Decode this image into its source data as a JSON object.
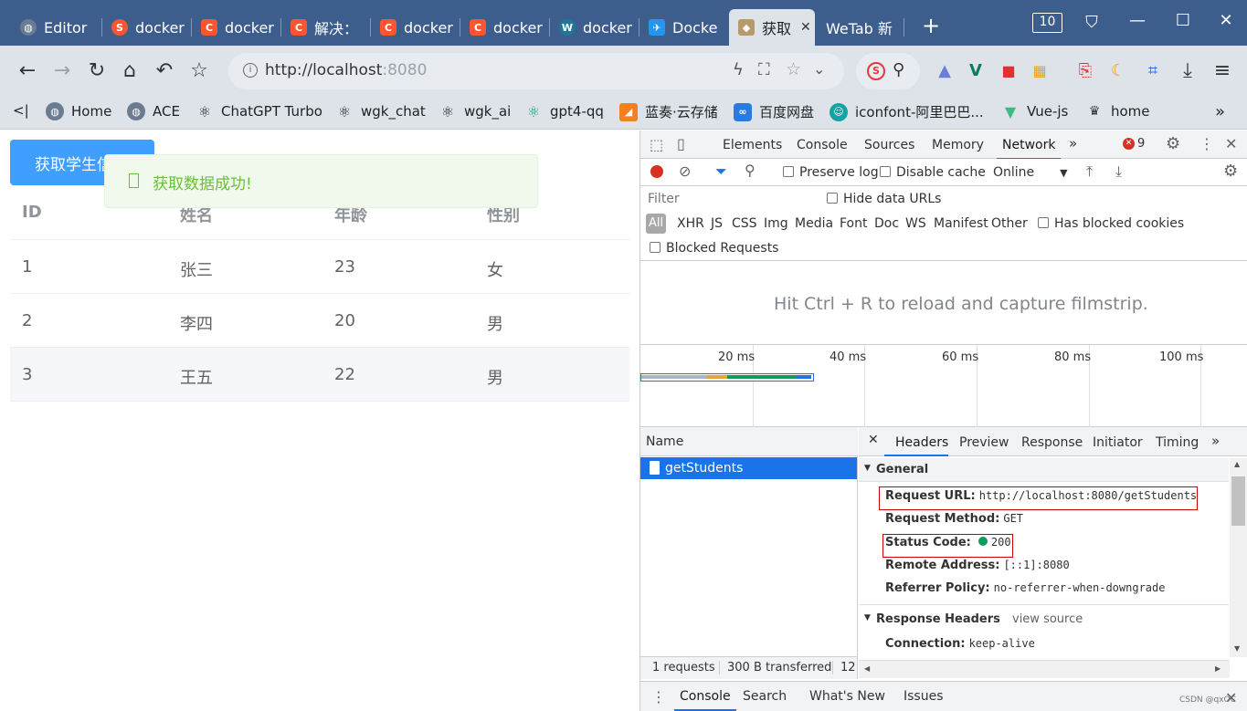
{
  "browser": {
    "tabs": [
      {
        "title": "Editor",
        "favicon": "globe-icon",
        "color": "#5f6368"
      },
      {
        "title": "docker",
        "favicon": "sogou-icon",
        "color": "#fc5531"
      },
      {
        "title": "docker",
        "favicon": "csdn-icon",
        "color": "#fc5531"
      },
      {
        "title": "解决：",
        "favicon": "csdn-icon",
        "color": "#fc5531"
      },
      {
        "title": "docker",
        "favicon": "csdn-icon",
        "color": "#fc5531"
      },
      {
        "title": "docker",
        "favicon": "csdn-icon",
        "color": "#fc5531"
      },
      {
        "title": "docker",
        "favicon": "wordpress-icon",
        "color": "#21759b"
      },
      {
        "title": "Docke",
        "favicon": "docker-icon",
        "color": "#2496ed"
      },
      {
        "title": "获取",
        "favicon": "vue-icon",
        "color": "#888888",
        "active": true
      },
      {
        "title": "WeTab 新",
        "favicon": "",
        "color": ""
      }
    ],
    "tab_count": "10",
    "new_tab": "+",
    "url_host": "http://localhost",
    "url_port": ":8080",
    "bookmarks": [
      {
        "label": "<|",
        "icon": ""
      },
      {
        "label": "Home",
        "icon": "globe-icon"
      },
      {
        "label": "ACE",
        "icon": "globe-icon"
      },
      {
        "label": "ChatGPT Turbo",
        "icon": "openai-icon"
      },
      {
        "label": "wgk_chat",
        "icon": "openai-icon"
      },
      {
        "label": "wgk_ai",
        "icon": "openai-icon"
      },
      {
        "label": "gpt4-qq",
        "icon": "openai-icon"
      },
      {
        "label": "蓝奏·云存储",
        "icon": "lanzou-icon"
      },
      {
        "label": "百度网盘",
        "icon": "baidu-icon"
      },
      {
        "label": "iconfont-阿里巴巴...",
        "icon": "iconfont-icon"
      },
      {
        "label": "Vue-js",
        "icon": "vue-icon"
      },
      {
        "label": "home",
        "icon": "home-icon"
      }
    ],
    "bookmarks_more": "»"
  },
  "page": {
    "button_label": "获取学生信息",
    "toast_message": "获取数据成功!",
    "toast_icon": "success-icon",
    "table": {
      "headers": [
        "ID",
        "姓名",
        "年龄",
        "性别"
      ],
      "rows": [
        [
          "1",
          "张三",
          "23",
          "女"
        ],
        [
          "2",
          "李四",
          "20",
          "男"
        ],
        [
          "3",
          "王五",
          "22",
          "男"
        ]
      ]
    }
  },
  "devtools": {
    "tabs": [
      "Elements",
      "Console",
      "Sources",
      "Memory",
      "Network"
    ],
    "selected_tab": "Network",
    "more": "»",
    "error_count": "9",
    "preserve_log": "Preserve log",
    "disable_cache": "Disable cache",
    "throttle": "Online",
    "filter_placeholder": "Filter",
    "hide_data_urls": "Hide data URLs",
    "filter_types": [
      "All",
      "XHR",
      "JS",
      "CSS",
      "Img",
      "Media",
      "Font",
      "Doc",
      "WS",
      "Manifest",
      "Other"
    ],
    "has_blocked_cookies": "Has blocked cookies",
    "blocked_requests": "Blocked Requests",
    "filmstrip_hint": "Hit Ctrl + R to reload and capture filmstrip.",
    "timeline_ticks": [
      "20 ms",
      "40 ms",
      "60 ms",
      "80 ms",
      "100 ms"
    ],
    "name_header": "Name",
    "requests": [
      "getStudents"
    ],
    "detail_tabs": [
      "Headers",
      "Preview",
      "Response",
      "Initiator",
      "Timing"
    ],
    "general_title": "General",
    "general": [
      {
        "key": "Request URL:",
        "value": "http://localhost:8080/getStudents"
      },
      {
        "key": "Request Method:",
        "value": "GET"
      },
      {
        "key": "Status Code:",
        "value": "200"
      },
      {
        "key": "Remote Address:",
        "value": "[::1]:8080"
      },
      {
        "key": "Referrer Policy:",
        "value": "no-referrer-when-downgrade"
      }
    ],
    "response_headers_title": "Response Headers",
    "view_source": "view source",
    "response_headers": [
      {
        "key": "Connection:",
        "value": "keep-alive"
      }
    ],
    "summary_requests": "1 requests",
    "summary_transferred": "300 B transferred",
    "summary_more": "12",
    "drawer_tabs": [
      "Console",
      "Search",
      "What's New",
      "Issues"
    ],
    "watermark": "CSDN @qxOC"
  }
}
